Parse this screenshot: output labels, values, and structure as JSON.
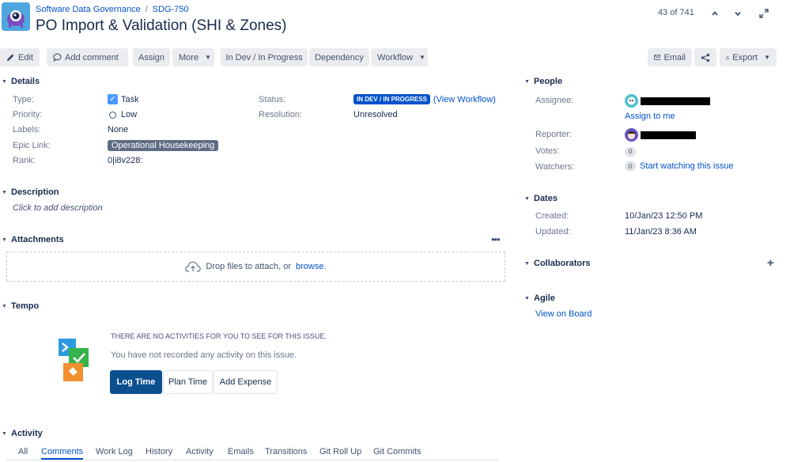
{
  "header": {
    "project": "Software Data Governance",
    "separator": "/",
    "issue_key": "SDG-750",
    "title": "PO Import & Validation (SHI & Zones)",
    "pager": "43 of 741"
  },
  "toolbar": {
    "edit": "Edit",
    "add_comment": "Add comment",
    "assign": "Assign",
    "more": "More",
    "in_dev": "In Dev / In Progress",
    "dependency": "Dependency",
    "workflow": "Workflow",
    "email": "Email",
    "export": "Export"
  },
  "details": {
    "heading": "Details",
    "type_label": "Type:",
    "type_value": "Task",
    "priority_label": "Priority:",
    "priority_value": "Low",
    "labels_label": "Labels:",
    "labels_value": "None",
    "epic_label": "Epic Link:",
    "epic_value": "Operational Housekeeping",
    "rank_label": "Rank:",
    "rank_value": "0|i8v228:",
    "status_label": "Status:",
    "status_value": "IN DEV / IN PROGRESS",
    "view_workflow": "(View Workflow)",
    "resolution_label": "Resolution:",
    "resolution_value": "Unresolved"
  },
  "description": {
    "heading": "Description",
    "placeholder": "Click to add description"
  },
  "attachments": {
    "heading": "Attachments",
    "drop_text": "Drop files to attach, or",
    "browse": "browse."
  },
  "tempo": {
    "heading": "Tempo",
    "empty_title": "THERE ARE NO ACTIVITIES FOR YOU TO SEE FOR THIS ISSUE.",
    "empty_text": "You have not recorded any activity on this issue.",
    "log_time": "Log Time",
    "plan_time": "Plan Time",
    "add_expense": "Add Expense"
  },
  "activity": {
    "heading": "Activity",
    "tabs": [
      "All",
      "Comments",
      "Work Log",
      "History",
      "Activity",
      "Emails",
      "Transitions",
      "Git Roll Up",
      "Git Commits"
    ],
    "active_tab": "Comments"
  },
  "people": {
    "heading": "People",
    "assignee_label": "Assignee:",
    "assign_to_me": "Assign to me",
    "reporter_label": "Reporter:",
    "votes_label": "Votes:",
    "votes_count": "0",
    "watchers_label": "Watchers:",
    "watchers_count": "0",
    "start_watching": "Start watching this issue"
  },
  "dates": {
    "heading": "Dates",
    "created_label": "Created:",
    "created_value": "10/Jan/23 12:50 PM",
    "updated_label": "Updated:",
    "updated_value": "11/Jan/23 8:36 AM"
  },
  "collaborators": {
    "heading": "Collaborators"
  },
  "agile": {
    "heading": "Agile",
    "view_on_board": "View on Board"
  },
  "colors": {
    "accent": "#0052cc",
    "status": "#0052cc",
    "epic": "#5e6c84",
    "log_time": "#0b4f8f"
  }
}
